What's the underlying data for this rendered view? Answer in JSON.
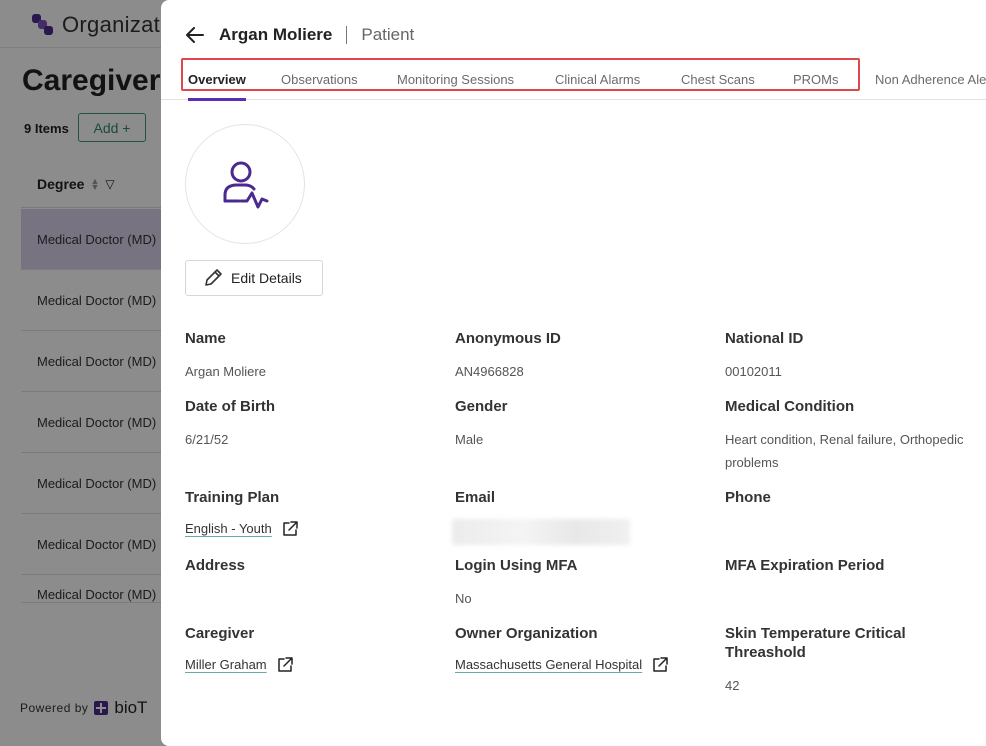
{
  "background": {
    "app_name": "Organizat",
    "page_title": "Caregivers",
    "items_count": "9 Items",
    "add_button": "Add +",
    "column_header": "Degree",
    "rows": [
      "Medical Doctor (MD)",
      "Medical Doctor (MD)",
      "Medical Doctor (MD)",
      "Medical Doctor (MD)",
      "Medical Doctor (MD)",
      "Medical Doctor (MD)",
      "Medical Doctor (MD)"
    ],
    "powered_by": "Powered by",
    "brand": "bioT"
  },
  "drawer": {
    "patient_name": "Argan Moliere",
    "entity_type": "Patient",
    "tabs": [
      {
        "label": "Overview",
        "active": true
      },
      {
        "label": "Observations"
      },
      {
        "label": "Monitoring Sessions"
      },
      {
        "label": "Clinical Alarms"
      },
      {
        "label": "Chest Scans"
      },
      {
        "label": "PROMs"
      },
      {
        "label": "Non Adherence Ale"
      }
    ],
    "edit_button": "Edit Details",
    "fields": {
      "name": {
        "label": "Name",
        "value": "Argan Moliere"
      },
      "anonymous_id": {
        "label": "Anonymous ID",
        "value": "AN4966828"
      },
      "national_id": {
        "label": "National ID",
        "value": "00102011"
      },
      "date_of_birth": {
        "label": "Date of Birth",
        "value": "6/21/52"
      },
      "gender": {
        "label": "Gender",
        "value": "Male"
      },
      "medical_condition": {
        "label": "Medical Condition",
        "value": "Heart condition, Renal failure, Orthopedic problems"
      },
      "training_plan": {
        "label": "Training Plan",
        "value": "English - Youth"
      },
      "email": {
        "label": "Email",
        "value": ""
      },
      "phone": {
        "label": "Phone",
        "value": ""
      },
      "address": {
        "label": "Address",
        "value": ""
      },
      "login_mfa": {
        "label": "Login Using MFA",
        "value": "No"
      },
      "mfa_expiration": {
        "label": "MFA Expiration Period",
        "value": ""
      },
      "caregiver": {
        "label": "Caregiver",
        "value": "Miller Graham"
      },
      "owner_org": {
        "label": "Owner Organization",
        "value": "Massachusetts General Hospital"
      },
      "skin_temp": {
        "label": "Skin Temperature Critical Threashold",
        "value": "42"
      }
    }
  },
  "colors": {
    "accent": "#5b2fb0",
    "highlight_box": "#e0474c",
    "add_button": "#3a9a7a"
  }
}
